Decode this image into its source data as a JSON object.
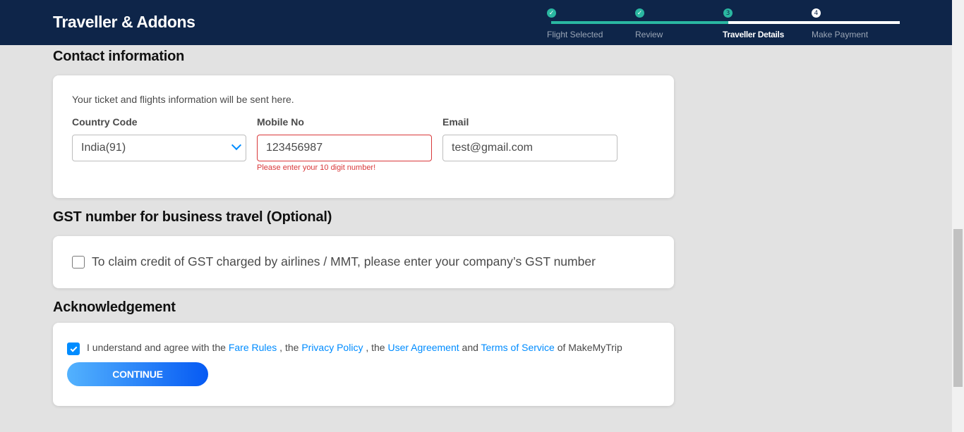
{
  "header": {
    "title": "Traveller & Addons",
    "steps": [
      {
        "label": "Flight Selected",
        "marker": "✓",
        "state": "done"
      },
      {
        "label": "Review",
        "marker": "✓",
        "state": "done"
      },
      {
        "label": "Traveller Details",
        "marker": "3",
        "state": "current"
      },
      {
        "label": "Make Payment",
        "marker": "4",
        "state": "upcoming"
      }
    ],
    "progress_fraction": 0.5
  },
  "contact": {
    "title": "Contact information",
    "hint": "Your ticket and flights information will be sent here.",
    "country_code_label": "Country Code",
    "country_code_value": "India(91)",
    "mobile_label": "Mobile No",
    "mobile_value": "123456987",
    "mobile_error": "Please enter your 10 digit number!",
    "email_label": "Email",
    "email_value": "test@gmail.com"
  },
  "gst": {
    "title": "GST number for business travel (Optional)",
    "checkbox_label": "To claim credit of GST charged by airlines / MMT, please enter your company’s GST number",
    "checked": false
  },
  "acknowledgement": {
    "title": "Acknowledgement",
    "checked": true,
    "text_prefix": "I understand and agree with the",
    "link_fare_rules": "Fare Rules",
    "sep_1": ", the",
    "link_privacy": "Privacy Policy",
    "sep_2": ", the",
    "link_user_agreement": "User Agreement",
    "sep_3": "and",
    "link_terms": "Terms of Service",
    "text_suffix": "of MakeMyTrip",
    "continue_label": "CONTINUE"
  },
  "colors": {
    "header_bg": "#0e2549",
    "progress": "#2ab7a1",
    "link": "#008cff",
    "error": "#d9383a"
  }
}
